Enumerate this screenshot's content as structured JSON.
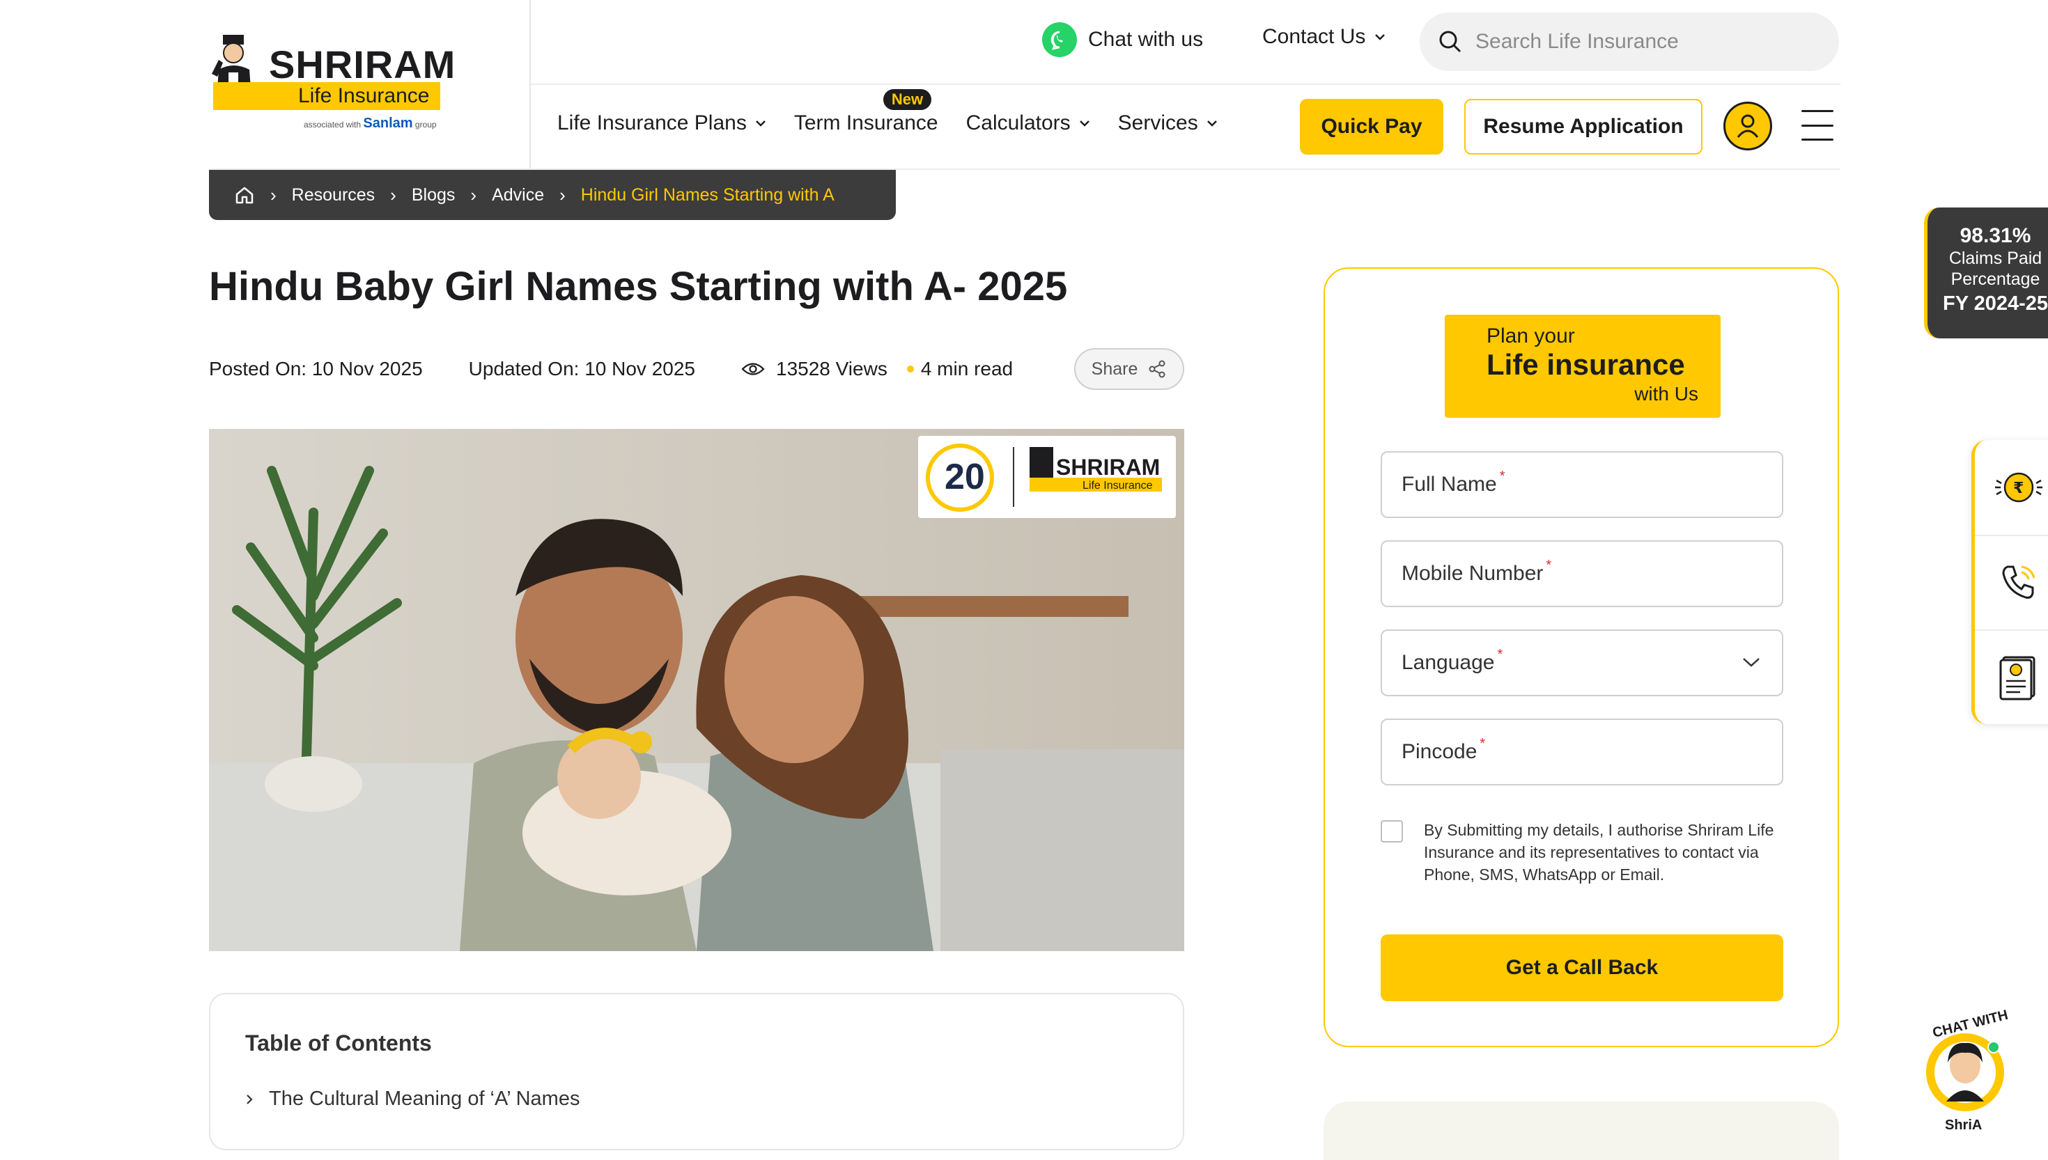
{
  "header": {
    "logo": {
      "brand": "SHRIRAM",
      "sub": "Life Insurance",
      "associated": "associated with",
      "partner": "Sanlam",
      "group": "group"
    },
    "chat_label": "Chat with us",
    "contact_label": "Contact Us",
    "search_placeholder": "Search Life Insurance",
    "nav": [
      {
        "label": "Life Insurance Plans",
        "has_dropdown": true
      },
      {
        "label": "Term Insurance",
        "badge": "New"
      },
      {
        "label": "Calculators",
        "has_dropdown": true
      },
      {
        "label": "Services",
        "has_dropdown": true
      }
    ],
    "quick_pay": "Quick Pay",
    "resume_application": "Resume Application"
  },
  "breadcrumb": [
    "Resources",
    "Blogs",
    "Advice",
    "Hindu Girl Names Starting with A"
  ],
  "article": {
    "title": "Hindu Baby Girl Names Starting with A- 2025",
    "posted": "Posted On: 10 Nov 2025",
    "updated": "Updated On: 10 Nov 2025",
    "views": "13528 Views",
    "read_time": "4 min read",
    "share": "Share",
    "hero_badge": {
      "years": "20",
      "brand": "SHRIRAM",
      "sub": "Life Insurance"
    }
  },
  "toc": {
    "title": "Table of Contents",
    "items": [
      "The Cultural Meaning of ‘A’ Names"
    ]
  },
  "form": {
    "plan_line1": "Plan your",
    "plan_line2": "Life insurance",
    "plan_line3": "with Us",
    "full_name": "Full Name",
    "mobile": "Mobile Number",
    "language": "Language",
    "pincode": "Pincode",
    "required_mark": "*",
    "consent": "By Submitting my details, I authorise Shriram Life Insurance and its representatives to contact via Phone, SMS, WhatsApp or Email.",
    "submit": "Get a Call Back"
  },
  "claims": {
    "value": "98.31%",
    "line1": "Claims Paid",
    "line2": "Percentage",
    "fy": "FY 2024-25"
  },
  "chatbot": {
    "top": "CHAT WITH",
    "name": "ShriA"
  },
  "colors": {
    "accent": "#ffc800",
    "dark": "#3c3c3c",
    "text": "#1d1d1f",
    "required": "#e0282e"
  },
  "icons": [
    "whatsapp-icon",
    "chevron-down-icon",
    "search-icon",
    "user-icon",
    "menu-icon",
    "home-icon",
    "eye-icon",
    "share-icon",
    "rupee-coin-icon",
    "phone-call-icon",
    "document-icon",
    "chatbot-avatar-icon"
  ]
}
